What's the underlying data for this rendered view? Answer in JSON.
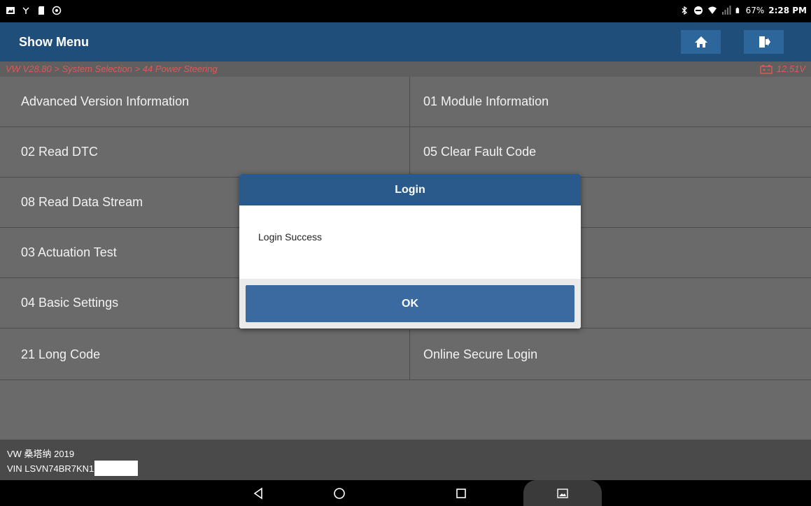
{
  "status_bar": {
    "battery": "67%",
    "time": "2:28 PM"
  },
  "title_bar": {
    "title": "Show Menu"
  },
  "breadcrumb": {
    "path": "VW V28.80 > System Selection > 44 Power Steering",
    "voltage": "12.51V"
  },
  "menu": {
    "items": [
      "Advanced Version Information",
      "01 Module Information",
      "02 Read DTC",
      "05 Clear Fault Code",
      "08 Read Data Stream",
      "",
      "03 Actuation Test",
      "",
      "04 Basic Settings",
      "",
      "21 Long Code",
      "Online Secure Login"
    ]
  },
  "footer": {
    "model": "VW 桑塔纳 2019",
    "vin": "VIN LSVN74BR7KN1"
  },
  "dialog": {
    "title": "Login",
    "message": "Login Success",
    "ok_label": "OK"
  },
  "colors": {
    "title_bar": "#1f4e7a",
    "dialog_header": "#2a5a8c",
    "ok_button": "#3a6aa0",
    "breadcrumb_text": "#e05858",
    "menu_bg": "#6a6a6a"
  }
}
